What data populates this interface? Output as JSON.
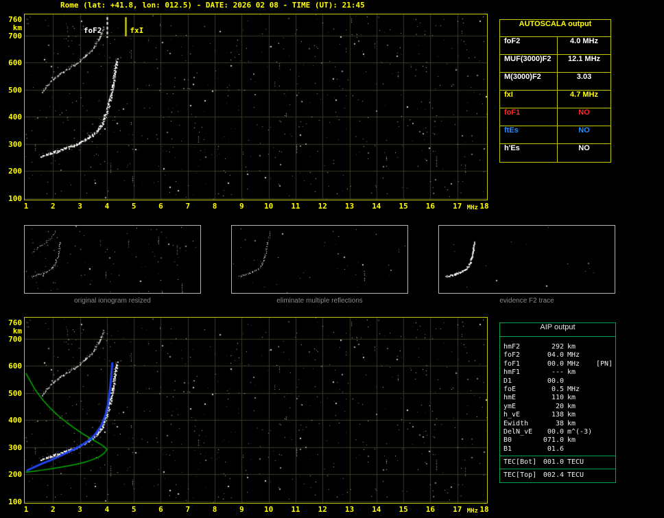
{
  "title": "Rome (lat: +41.8, lon: 012.5) - DATE: 2026 02 08 - TIME (UT): 21:45",
  "colors": {
    "background": "#000000",
    "title_text": "#ffff00",
    "axis_text": "#ffff00",
    "plot_border": "#c8c800",
    "grid": "#3a3a28",
    "echo_dots": "#ffffff",
    "foF2_marker": "#ffffff",
    "fxI_marker": "#ffff00",
    "profile_line": "#00b400",
    "restored_trace": "#2244ee",
    "autoscala_border": "#c8c800",
    "autoscala_header": "#ffff00",
    "aip_border": "#00a44c",
    "aip_text": "#f0f0f0",
    "thumb_border": "#b4b4b4",
    "caption_text": "#8a8a8a",
    "value_white": "#ffffff",
    "value_yellow": "#ffff00",
    "value_red": "#ff2828",
    "value_blue": "#2a8cff"
  },
  "autoscala": {
    "header": "AUTOSCALA output",
    "rows": [
      {
        "label": "foF2",
        "value": "4.0 MHz",
        "color": "#ffffff"
      },
      {
        "label": "MUF(3000)F2",
        "value": "12.1 MHz",
        "color": "#ffffff"
      },
      {
        "label": "M(3000)F2",
        "value": "3.03",
        "color": "#ffffff"
      },
      {
        "label": "fxI",
        "value": "4.7 MHz",
        "color": "#ffff00"
      },
      {
        "label": "foF1",
        "value": "NO",
        "color": "#ff2828"
      },
      {
        "label": "ftEs",
        "value": "NO",
        "color": "#2a8cff"
      },
      {
        "label": "h'Es",
        "value": "NO",
        "color": "#ffffff"
      }
    ]
  },
  "aip": {
    "header": "AIP output",
    "rows": [
      {
        "label": "hmF2",
        "value": "292",
        "unit": "km",
        "extra": "",
        "sep_above": false
      },
      {
        "label": "foF2",
        "value": "04.0",
        "unit": "MHz",
        "extra": "",
        "sep_above": false
      },
      {
        "label": "foF1",
        "value": "00.0",
        "unit": "MHz",
        "extra": "[PN]",
        "sep_above": false
      },
      {
        "label": "hmF1",
        "value": "---",
        "unit": "km",
        "extra": "",
        "sep_above": false
      },
      {
        "label": "D1",
        "value": "00.0",
        "unit": "",
        "extra": "",
        "sep_above": false
      },
      {
        "label": "foE",
        "value": "0.5",
        "unit": "MHz",
        "extra": "",
        "sep_above": false
      },
      {
        "label": "hmE",
        "value": "110",
        "unit": "km",
        "extra": "",
        "sep_above": false
      },
      {
        "label": "ymE",
        "value": "20",
        "unit": "km",
        "extra": "",
        "sep_above": false
      },
      {
        "label": "h_vE",
        "value": "138",
        "unit": "km",
        "extra": "",
        "sep_above": false
      },
      {
        "label": "Ewidth",
        "value": "38",
        "unit": "km",
        "extra": "",
        "sep_above": false
      },
      {
        "label": "DelN_vE",
        "value": "00.0",
        "unit": "m^(-3)",
        "extra": "",
        "sep_above": false
      },
      {
        "label": "B0",
        "value": "071.0",
        "unit": "km",
        "extra": "",
        "sep_above": false
      },
      {
        "label": "B1",
        "value": "01.6",
        "unit": "",
        "extra": "",
        "sep_above": false
      },
      {
        "label": "TEC[Bot]",
        "value": "001.0",
        "unit": "TECU",
        "extra": "",
        "sep_above": true
      },
      {
        "label": "TEC[Top]",
        "value": "002.4",
        "unit": "TECU",
        "extra": "",
        "sep_above": true
      }
    ]
  },
  "thumbnails": [
    {
      "caption": "original ionogram resized"
    },
    {
      "caption": "eliminate multiple reflections"
    },
    {
      "caption": "evidence F2 trace"
    }
  ],
  "chart_data": {
    "type": "scatter",
    "description": "Ionogram: virtual height (km) vs sounding frequency (MHz). Top panel: raw ionogram with AUTOSCALA markers. Bottom panel: same ionogram with restored F2 trace (blue) and electron density profile (green, nose at foF2=4.0 MHz / hmF2=292 km).",
    "x_unit": "MHz",
    "y_unit": "km",
    "xlim": [
      1,
      18
    ],
    "ylim": [
      100,
      760
    ],
    "xticks": [
      1,
      2,
      3,
      4,
      5,
      6,
      7,
      8,
      9,
      10,
      11,
      12,
      13,
      14,
      15,
      16,
      17,
      18
    ],
    "yticks": [
      760,
      700,
      600,
      500,
      400,
      300,
      200,
      100
    ],
    "markers": {
      "foF2_label": "foF2",
      "foF2_MHz": 4.0,
      "fxI_label": "fxI",
      "fxI_MHz": 4.7
    },
    "traces": {
      "f2_first_hop": [
        [
          1.55,
          255
        ],
        [
          1.7,
          262
        ],
        [
          1.9,
          268
        ],
        [
          2.1,
          274
        ],
        [
          2.3,
          280
        ],
        [
          2.5,
          287
        ],
        [
          2.7,
          294
        ],
        [
          2.9,
          302
        ],
        [
          3.1,
          312
        ],
        [
          3.3,
          324
        ],
        [
          3.5,
          338
        ],
        [
          3.65,
          355
        ],
        [
          3.8,
          375
        ],
        [
          3.9,
          400
        ],
        [
          4.0,
          430
        ],
        [
          4.1,
          465
        ],
        [
          4.18,
          505
        ],
        [
          4.25,
          545
        ],
        [
          4.3,
          585
        ],
        [
          4.35,
          615
        ]
      ],
      "f2_second_hop": [
        [
          1.6,
          495
        ],
        [
          1.8,
          520
        ],
        [
          2.0,
          540
        ],
        [
          2.2,
          556
        ],
        [
          2.4,
          570
        ],
        [
          2.6,
          583
        ],
        [
          2.8,
          596
        ],
        [
          3.0,
          610
        ],
        [
          3.2,
          626
        ],
        [
          3.4,
          645
        ],
        [
          3.55,
          665
        ],
        [
          3.7,
          688
        ],
        [
          3.8,
          712
        ],
        [
          3.88,
          735
        ]
      ],
      "restored_trace_blue": [
        [
          1.05,
          215
        ],
        [
          1.3,
          227
        ],
        [
          1.6,
          240
        ],
        [
          1.9,
          252
        ],
        [
          2.2,
          265
        ],
        [
          2.5,
          279
        ],
        [
          2.8,
          293
        ],
        [
          3.1,
          310
        ],
        [
          3.4,
          330
        ],
        [
          3.6,
          352
        ],
        [
          3.8,
          382
        ],
        [
          3.95,
          420
        ],
        [
          4.05,
          465
        ],
        [
          4.12,
          520
        ],
        [
          4.17,
          575
        ],
        [
          4.2,
          610
        ]
      ],
      "profile_topside_green": [
        [
          1.0,
          572
        ],
        [
          1.3,
          518
        ],
        [
          1.6,
          477
        ],
        [
          1.9,
          444
        ],
        [
          2.2,
          416
        ],
        [
          2.5,
          392
        ],
        [
          2.8,
          370
        ],
        [
          3.1,
          350
        ],
        [
          3.4,
          332
        ],
        [
          3.7,
          315
        ],
        [
          3.9,
          302
        ],
        [
          4.0,
          292
        ]
      ],
      "profile_bottomside_green": [
        [
          4.0,
          292
        ],
        [
          3.9,
          278
        ],
        [
          3.7,
          264
        ],
        [
          3.4,
          252
        ],
        [
          3.1,
          243
        ],
        [
          2.8,
          236
        ],
        [
          2.5,
          230
        ],
        [
          2.2,
          225
        ],
        [
          1.9,
          220
        ],
        [
          1.6,
          216
        ],
        [
          1.3,
          212
        ],
        [
          1.0,
          208
        ]
      ]
    }
  }
}
